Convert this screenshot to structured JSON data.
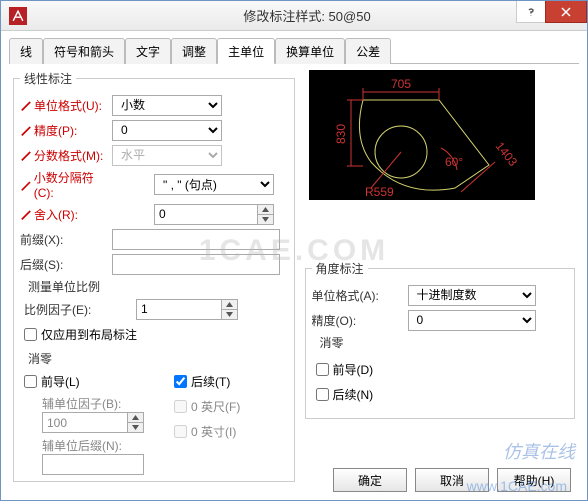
{
  "header": {
    "title": "修改标注样式: 50@50"
  },
  "tabs": {
    "items": [
      "线",
      "符号和箭头",
      "文字",
      "调整",
      "主单位",
      "换算单位",
      "公差"
    ],
    "active": "主单位"
  },
  "linear": {
    "legend": "线性标注",
    "unit_format_label": "单位格式(U):",
    "unit_format_value": "小数",
    "precision_label": "精度(P):",
    "precision_value": "0",
    "fraction_format_label": "分数格式(M):",
    "fraction_format_value": "水平",
    "decimal_sep_label": "小数分隔符(C):",
    "decimal_sep_value": "\" , \" (句点)",
    "round_label": "舍入(R):",
    "round_value": "0",
    "prefix_label": "前缀(X):",
    "prefix_value": "",
    "suffix_label": "后缀(S):",
    "suffix_value": ""
  },
  "scale": {
    "legend": "测量单位比例",
    "factor_label": "比例因子(E):",
    "factor_value": "1",
    "layout_only_label": "仅应用到布局标注"
  },
  "zero_suppress": {
    "legend": "消零",
    "leading_label": "前导(L)",
    "trailing_label": "后续(T)",
    "trailing_checked": true,
    "aux_factor_label": "辅单位因子(B):",
    "aux_factor_value": "100",
    "aux_suffix_label": "辅单位后缀(N):",
    "aux_suffix_value": "",
    "feet_label": "0 英尺(F)",
    "inch_label": "0 英寸(I)"
  },
  "angular": {
    "legend": "角度标注",
    "unit_format_label": "单位格式(A):",
    "unit_format_value": "十进制度数",
    "precision_label": "精度(O):",
    "precision_value": "0",
    "zero_legend": "消零",
    "leading_label": "前导(D)",
    "trailing_label": "后续(N)"
  },
  "preview": {
    "dims": {
      "top": "705",
      "left": "830",
      "radius": "R559",
      "angle": "60°",
      "right": "1403"
    }
  },
  "buttons": {
    "ok": "确定",
    "cancel": "取消",
    "help": "帮助(H)"
  },
  "watermark": {
    "side": "仿真在线",
    "url": "www.1CAE.com",
    "center": "1CAE.COM"
  }
}
